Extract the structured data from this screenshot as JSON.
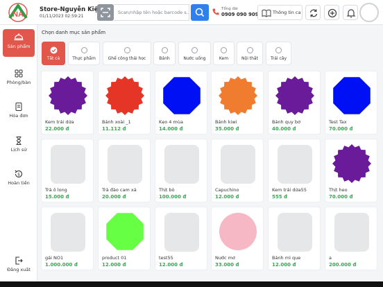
{
  "header": {
    "logo_text": "NA",
    "store_name": "Store-Nguyễn Kiệm",
    "datetime": "01/11/2023 02:59:21",
    "search_placeholder": "Scan/nhập tên hoặc barcode s...",
    "hotline_label": "Tổng đài",
    "hotline_number": "0909 090 909",
    "info_label": "Thông tin ca"
  },
  "sidebar": {
    "items": [
      {
        "label": "Sản phẩm",
        "icon": "bell-cloche-icon"
      },
      {
        "label": "Phòng/bàn",
        "icon": "grid-icon"
      },
      {
        "label": "Hóa đơn",
        "icon": "receipt-icon"
      },
      {
        "label": "Lịch sử",
        "icon": "hourglass-icon"
      },
      {
        "label": "Hoàn tiền",
        "icon": "refund-icon"
      }
    ],
    "logout_label": "Đăng xuất"
  },
  "main": {
    "category_title": "Chọn danh mục sản phẩm",
    "categories": [
      {
        "label": "Tất cả"
      },
      {
        "label": "Thực phẩm"
      },
      {
        "label": "Ghế công thái học"
      },
      {
        "label": "Bánh"
      },
      {
        "label": "Nước uống"
      },
      {
        "label": "Kem"
      },
      {
        "label": "Nội thất"
      },
      {
        "label": "Trái cây"
      }
    ],
    "products": [
      {
        "name": "Kem trái dứa",
        "price": "22.000 đ",
        "shape": "star",
        "color": "#6a1b9a"
      },
      {
        "name": "Bánh xoài _1",
        "price": "11.112 đ",
        "shape": "star",
        "color": "#e53527"
      },
      {
        "name": "Kẹo 4 mùa",
        "price": "14.000 đ",
        "shape": "octagon",
        "color": "#0010f5"
      },
      {
        "name": "Bánh kiwi",
        "price": "35.000 đ",
        "shape": "star",
        "color": "#f07c30"
      },
      {
        "name": "Bánh quy bơ",
        "price": "40.000 đ",
        "shape": "star",
        "color": "#6a1b9a"
      },
      {
        "name": "Test Tax",
        "price": "70.000 đ",
        "shape": "octagon",
        "color": "#0010f5"
      },
      {
        "name": "Trà ô long",
        "price": "15.000 đ",
        "shape": "placeholder",
        "color": "#e6e7e9"
      },
      {
        "name": "Trà đào cam xả",
        "price": "20.000 đ",
        "shape": "placeholder",
        "color": "#e6e7e9"
      },
      {
        "name": "Thịt bò",
        "price": "100.000 đ",
        "shape": "placeholder",
        "color": "#e6e7e9"
      },
      {
        "name": "Capuchino",
        "price": "12.000 đ",
        "shape": "placeholder",
        "color": "#e6e7e9"
      },
      {
        "name": "Kem trái dứa55",
        "price": "555 đ",
        "shape": "placeholder",
        "color": "#e6e7e9"
      },
      {
        "name": "Thịt heo",
        "price": "70.000 đ",
        "shape": "star",
        "color": "#6a1b9a"
      },
      {
        "name": "gái NO1",
        "price": "1.000.000 đ",
        "shape": "placeholder",
        "color": "#e6e7e9"
      },
      {
        "name": "product 01",
        "price": "12.000 đ",
        "shape": "octagon",
        "color": "#66ff44"
      },
      {
        "name": "test55",
        "price": "12.000 đ",
        "shape": "placeholder",
        "color": "#e6e7e9"
      },
      {
        "name": "Nước mơ",
        "price": "33.000 đ",
        "shape": "circle",
        "color": "#f5b8c4"
      },
      {
        "name": "Bánh mì que",
        "price": "12.000 đ",
        "shape": "placeholder",
        "color": "#e6e7e9"
      },
      {
        "name": "a",
        "price": "200.000 đ",
        "shape": "placeholder",
        "color": "#e6e7e9"
      }
    ]
  },
  "colors": {
    "accent": "#e2574c",
    "primary": "#2f80ed",
    "price": "#34a853"
  }
}
